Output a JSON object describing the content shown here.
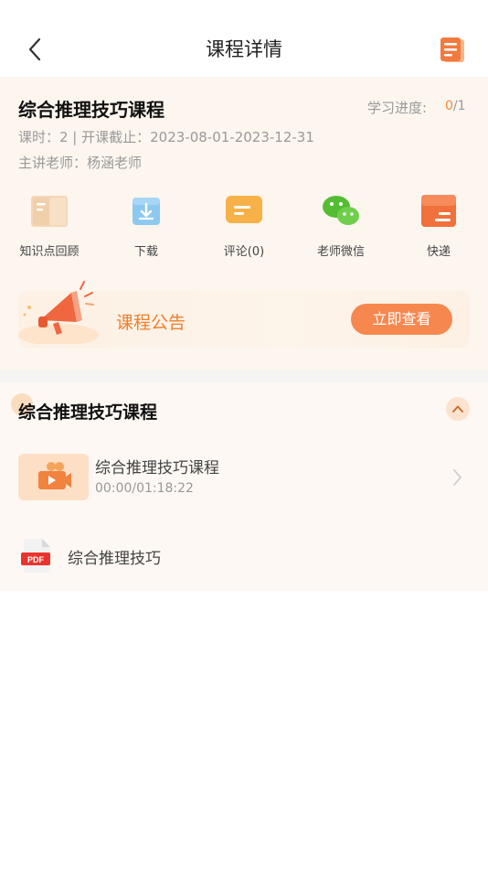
{
  "header": {
    "title": "课程详情",
    "back_icon": "chevron-left-icon",
    "doc_icon": "document-icon"
  },
  "course": {
    "title": "综合推理技巧课程",
    "progress_label": "学习进度:",
    "progress_current": "0",
    "progress_total": "/1",
    "lesson_line": "课时：2 | 开课截止：2023-08-01-2023-12-31",
    "teacher_line": "主讲老师：杨涵老师"
  },
  "actions": [
    {
      "label": "知识点回顾",
      "icon": "book-icon"
    },
    {
      "label": "下载",
      "icon": "download-icon"
    },
    {
      "label": "评论(0)",
      "icon": "comment-icon"
    },
    {
      "label": "老师微信",
      "icon": "wechat-icon"
    },
    {
      "label": "快递",
      "icon": "express-box-icon"
    }
  ],
  "notice": {
    "title": "课程公告",
    "button": "立即查看",
    "icon": "megaphone-icon"
  },
  "chapter": {
    "title": "综合推理技巧课程",
    "collapse_icon": "chevron-up-icon",
    "items": [
      {
        "type": "video",
        "title": "综合推理技巧课程",
        "time": "00:00/01:18:22",
        "icon": "video-icon"
      },
      {
        "type": "pdf",
        "title": "综合推理技巧",
        "icon": "pdf-icon",
        "icon_text": "PDF"
      }
    ]
  },
  "colors": {
    "accent": "#f6874f",
    "accent_text": "#f07f2c",
    "card_bg": "#fdf6ef"
  }
}
